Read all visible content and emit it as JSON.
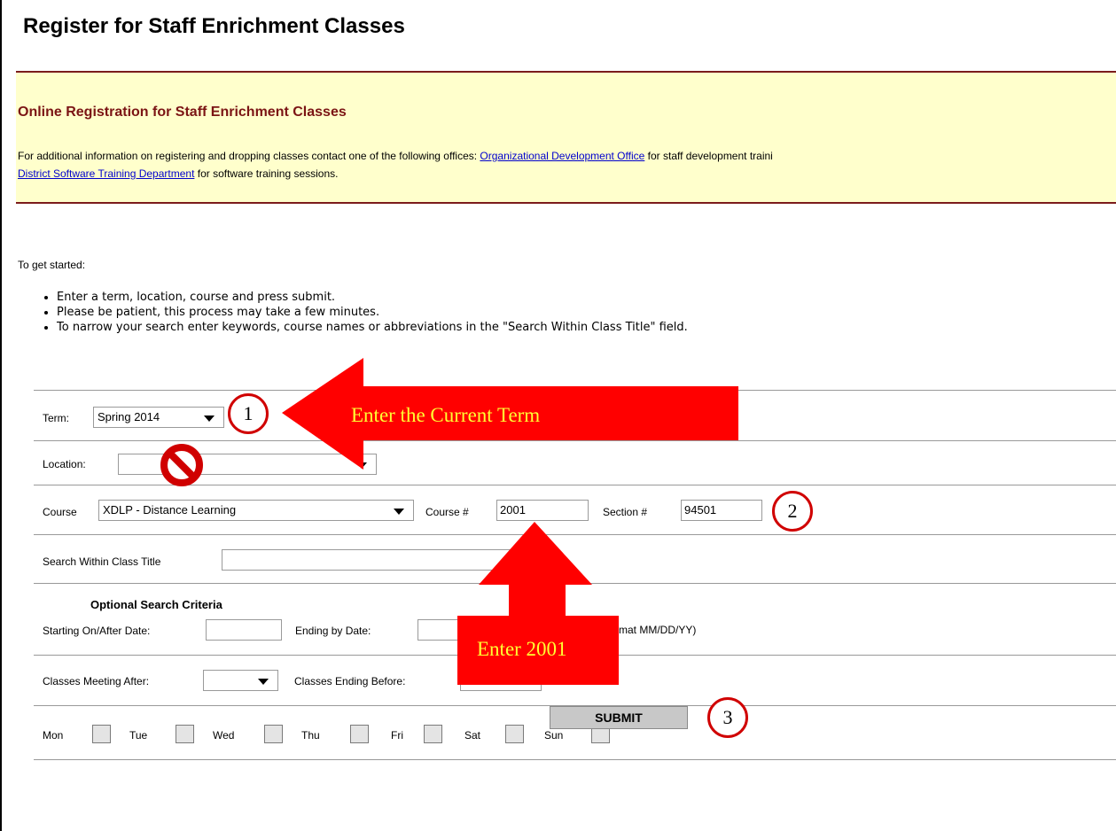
{
  "page": {
    "title": "Register for Staff Enrichment Classes"
  },
  "info": {
    "heading": "Online Registration for Staff Enrichment Classes",
    "line1_prefix": "For additional information on registering and dropping classes contact one of the following offices: ",
    "link1": "Organizational Development Office",
    "line1_suffix": " for staff development traini",
    "link2": "District Software Training Department",
    "line2_suffix": " for software training sessions."
  },
  "intro": {
    "label": "To get started:",
    "bullets": [
      "Enter a term, location, course and press submit.",
      "Please be patient, this process may take a few minutes.",
      "To narrow your search enter keywords, course names or abbreviations in the \"Search Within Class Title\" field."
    ]
  },
  "form": {
    "term_label": "Term:",
    "term_value": "Spring 2014",
    "location_label": "Location:",
    "location_value": "",
    "course_label": "Course",
    "course_value": "XDLP - Distance Learning",
    "course_num_label": "Course #",
    "course_num_value": "2001",
    "section_label": "Section #",
    "section_value": "94501",
    "search_label": "Search Within Class Title",
    "search_value": "",
    "optional_heading": "Optional Search Criteria",
    "start_label": "Starting On/After Date:",
    "end_label": "Ending by Date:",
    "format_hint": "rmat MM/DD/YY)",
    "meeting_after_label": "Classes Meeting After:",
    "ending_before_label": "Classes Ending Before:",
    "days": [
      "Mon",
      "Tue",
      "Wed",
      "Thu",
      "Fri",
      "Sat",
      "Sun"
    ],
    "submit_label": "SUBMIT"
  },
  "annotations": {
    "callout1": "1",
    "callout2": "2",
    "callout3": "3",
    "arrow1_text": "Enter the Current Term",
    "arrow2_text": "Enter 2001",
    "annotation_color": "#ff0000",
    "annotation_text_color": "#ffff33"
  }
}
